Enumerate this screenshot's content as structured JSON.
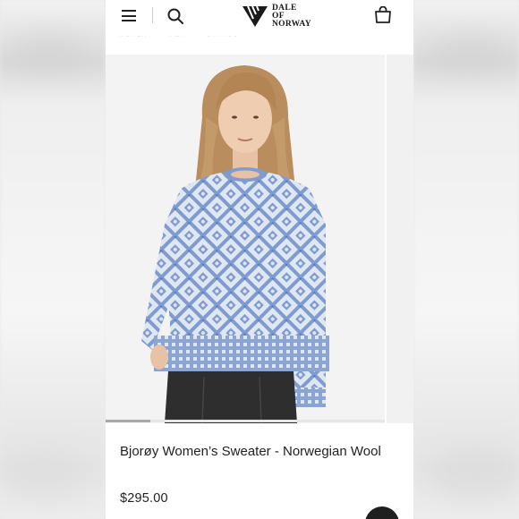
{
  "brand": {
    "logo_line1": "DALE",
    "logo_line2": "OF",
    "logo_line3": "NORWAY"
  },
  "subnav": {
    "items": [
      "WOMEN",
      "MEN",
      "BRANDS"
    ]
  },
  "gallery": {
    "image_alt": "Woman wearing blue and white Norwegian patterned sweater",
    "progress": 0.16
  },
  "product": {
    "title": "Bjorøy Women’s Sweater - Norwegian Wool",
    "price": "$295.00"
  },
  "colors": {
    "sweater_blue": "#7f9bcf",
    "sweater_light": "#dfe7f3",
    "pants": "#2e2e2e",
    "hair": "#b98d5d"
  },
  "icons": {
    "menu": "hamburger-icon",
    "search": "search-icon",
    "bag": "shopping-bag-icon",
    "chat": "chat-icon"
  }
}
